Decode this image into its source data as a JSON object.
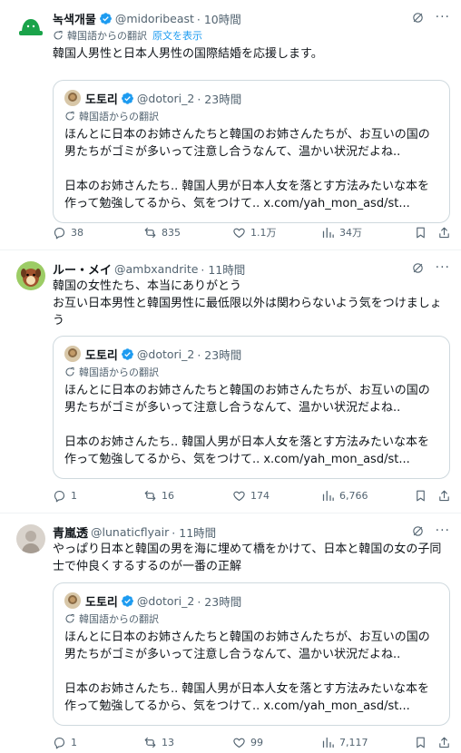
{
  "tweets": [
    {
      "name": "녹색개물",
      "handle": "@midoribeast",
      "time": "· 10時間",
      "translated_label": "韓国語からの翻訳",
      "show_original": "原文を表示",
      "text": "韓国人男性と日本人男性の国際結婚を応援します。",
      "quote": {
        "name": "도토리",
        "handle": "@dotori_2",
        "time": "· 23時間",
        "translated_label": "韓国語からの翻訳",
        "text": "ほんとに日本のお姉さんたちと韓国のお姉さんたちが、お互いの国の男たちがゴミが多いって注意し合うなんて、温かい状況だよね..\n\n日本のお姉さんたち.. 韓国人男が日本人女を落とす方法みたいな本を作って勉強してるから、気をつけて.. x.com/yah_mon_asd/st..."
      },
      "actions": {
        "replies": "38",
        "reposts": "835",
        "likes": "1.1万",
        "views": "34万"
      }
    },
    {
      "name": "ルー・メイ",
      "handle": "@ambxandrite",
      "time": "· 11時間",
      "text": "韓国の女性たち、本当にありがとう\nお互い日本男性と韓国男性に最低限以外は関わらないよう気をつけましょう",
      "quote": {
        "name": "도토리",
        "handle": "@dotori_2",
        "time": "· 23時間",
        "translated_label": "韓国語からの翻訳",
        "text": "ほんとに日本のお姉さんたちと韓国のお姉さんたちが、お互いの国の男たちがゴミが多いって注意し合うなんて、温かい状況だよね..\n\n日本のお姉さんたち.. 韓国人男が日本人女を落とす方法みたいな本を作って勉強してるから、気をつけて.. x.com/yah_mon_asd/st..."
      },
      "actions": {
        "replies": "1",
        "reposts": "16",
        "likes": "174",
        "views": "6,766"
      }
    },
    {
      "name": "青嵐透",
      "handle": "@lunaticflyair",
      "time": "· 11時間",
      "text": "やっぱり日本と韓国の男を海に埋めて橋をかけて、日本と韓国の女の子同士で仲良くするするのが一番の正解",
      "quote": {
        "name": "도토리",
        "handle": "@dotori_2",
        "time": "· 23時間",
        "translated_label": "韓国語からの翻訳",
        "text": "ほんとに日本のお姉さんたちと韓国のお姉さんたちが、お互いの国の男たちがゴミが多いって注意し合うなんて、温かい状況だよね..\n\n日本のお姉さんたち.. 韓国人男が日本人女を落とす方法みたいな本を作って勉強してるから、気をつけて.. x.com/yah_mon_asd/st..."
      },
      "actions": {
        "replies": "1",
        "reposts": "13",
        "likes": "99",
        "views": "7,117"
      }
    }
  ],
  "colors": {
    "accent": "#1d9bf0",
    "secondary_text": "#536471",
    "border": "#cfd9de"
  },
  "icons": [
    "verified-badge-icon",
    "grok-icon",
    "more-icon",
    "translate-icon",
    "reply-icon",
    "repost-icon",
    "like-icon",
    "views-icon",
    "bookmark-icon",
    "share-icon"
  ]
}
